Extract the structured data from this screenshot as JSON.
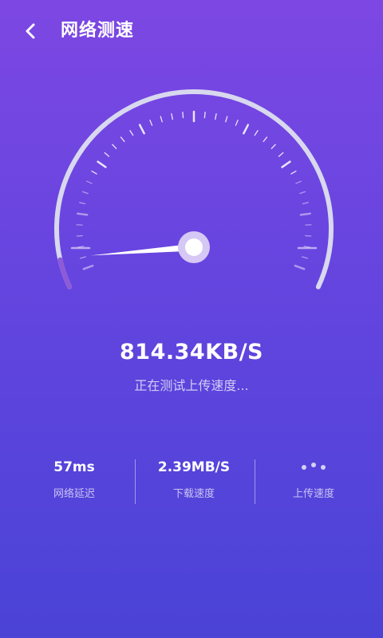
{
  "header": {
    "title": "网络测速",
    "back_icon": "chevron-left-icon"
  },
  "gauge": {
    "current_value": 814.34,
    "unit": "KB/S",
    "display": "814.34KB/S",
    "status": "正在测试上传速度...",
    "needle_fraction": 0.08,
    "colors": {
      "arc": "#d8d8ee",
      "progress": "#8e5bd8",
      "hub_outer": "#d6c8f5",
      "hub_inner": "#ffffff"
    }
  },
  "stats": [
    {
      "value": "57ms",
      "label": "网络延迟"
    },
    {
      "value": "2.39MB/S",
      "label": "下载速度"
    },
    {
      "value": "",
      "label": "上传速度",
      "icon": "loading-dots-icon"
    }
  ],
  "colors": {
    "background_top": "#7d47e3",
    "background_bottom": "#4a43d6"
  }
}
